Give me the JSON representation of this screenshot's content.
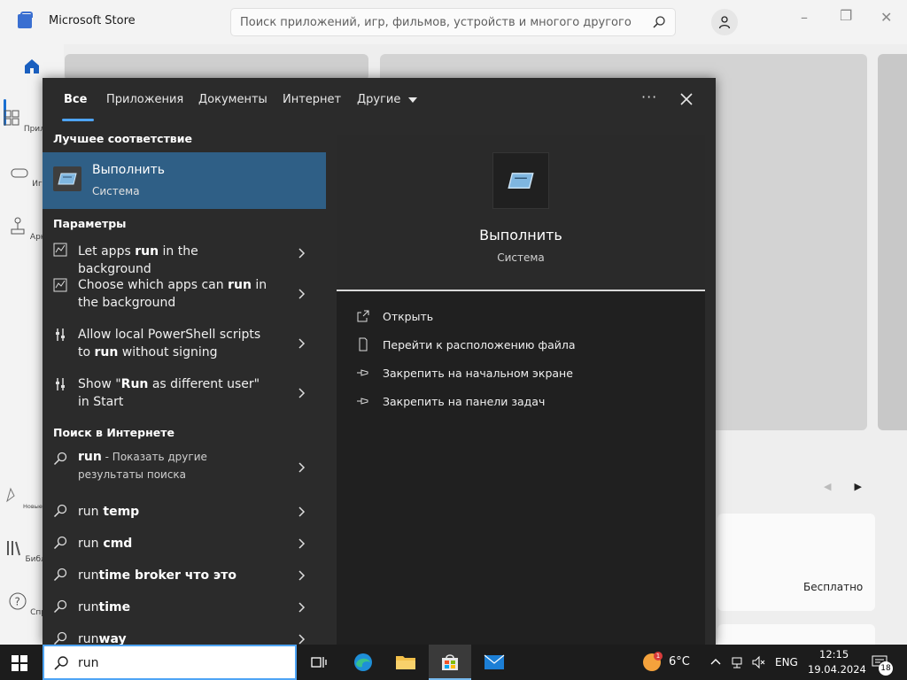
{
  "store": {
    "app_title": "Microsoft Store",
    "search_placeholder": "Поиск приложений, игр, фильмов, устройств и многого другого",
    "nav": [
      {
        "label": "Приложе"
      },
      {
        "label": "Игры"
      },
      {
        "label": "Аркад"
      },
      {
        "label": "Новые возмо"
      },
      {
        "label": "Библиот"
      },
      {
        "label": "Справ"
      }
    ],
    "free_label": "Бесплатно"
  },
  "search_panel": {
    "tabs": [
      "Все",
      "Приложения",
      "Документы",
      "Интернет",
      "Другие"
    ],
    "sections": {
      "best_match": "Лучшее соответствие",
      "settings": "Параметры",
      "web": "Поиск в Интернете"
    },
    "best_match": {
      "title": "Выполнить",
      "subtitle": "Система"
    },
    "settings_items": [
      {
        "pre": "Let apps ",
        "bold": "run",
        "post": " in the background"
      },
      {
        "pre": "Choose which apps can ",
        "bold": "run",
        "post": " in the background"
      },
      {
        "pre": "Allow local PowerShell scripts to ",
        "bold": "run",
        "post": " without signing"
      },
      {
        "pre": "Show \"",
        "bold": "Run",
        "post": " as different user\" in Start"
      }
    ],
    "web_items": [
      {
        "query": "run",
        "suffix": " - Показать другие результаты поиска"
      },
      {
        "query": "run",
        "bold": " temp"
      },
      {
        "query": "run",
        "bold": " cmd"
      },
      {
        "query": "run",
        "bold": "time broker что это"
      },
      {
        "query": "run",
        "bold": "time"
      },
      {
        "query": "run",
        "bold": "way"
      }
    ],
    "preview": {
      "title": "Выполнить",
      "subtitle": "Система",
      "actions": [
        "Открыть",
        "Перейти к расположению файла",
        "Закрепить на начальном экране",
        "Закрепить на панели задач"
      ]
    }
  },
  "taskbar": {
    "search_value": "run",
    "weather_temp": "6°C",
    "weather_badge": "1",
    "language": "ENG",
    "time": "12:15",
    "date": "19.04.2024",
    "notification_count": "18"
  },
  "colors": {
    "accent": "#4ea4f5",
    "selected_row": "#2f5f86",
    "panel_bg": "#2b2b2b",
    "preview_bg": "#202020"
  }
}
